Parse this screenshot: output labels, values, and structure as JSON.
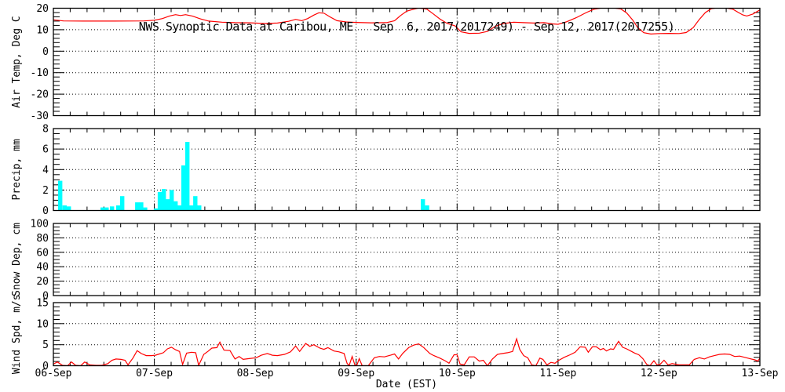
{
  "title": "NWS Synoptic Data at Caribou, ME   Sep  6, 2017(2017249) - Sep 12, 2017(2017255)",
  "xlabel": "Date (EST)",
  "colors": {
    "temp_line": "#ff0000",
    "wind_line": "#ff0000",
    "precip_bar": "#00ffff",
    "axis": "#000000",
    "background": "#ffffff"
  },
  "x_axis": {
    "tick_labels": [
      "06-Sep",
      "07-Sep",
      "08-Sep",
      "09-Sep",
      "10-Sep",
      "11-Sep",
      "12-Sep",
      "13-Sep"
    ],
    "domain_days": [
      0,
      7
    ],
    "minor_ticks_per_day": 6
  },
  "chart_data": [
    {
      "type": "line",
      "name": "air-temp",
      "ylabel": "Air Temp, Deg C",
      "ylim": [
        -30,
        20
      ],
      "yticks": [
        -30,
        -20,
        -10,
        0,
        10,
        20
      ],
      "minor_step": 2,
      "grid": [
        -20,
        -10,
        0,
        10
      ],
      "color": "#ff0000",
      "grid_on": true,
      "legend": "none",
      "series": [
        [
          0.0,
          14.6
        ],
        [
          0.1,
          14.1
        ],
        [
          0.3,
          14.0
        ],
        [
          0.6,
          14.0
        ],
        [
          0.9,
          14.1
        ],
        [
          1.0,
          14.4
        ],
        [
          1.08,
          15.2
        ],
        [
          1.15,
          16.4
        ],
        [
          1.21,
          17.0
        ],
        [
          1.26,
          16.6
        ],
        [
          1.31,
          17.0
        ],
        [
          1.38,
          16.3
        ],
        [
          1.46,
          15.0
        ],
        [
          1.54,
          14.0
        ],
        [
          1.67,
          13.5
        ],
        [
          1.8,
          13.3
        ],
        [
          1.95,
          13.2
        ],
        [
          2.1,
          12.9
        ],
        [
          2.22,
          13.1
        ],
        [
          2.33,
          13.9
        ],
        [
          2.4,
          14.8
        ],
        [
          2.46,
          14.2
        ],
        [
          2.52,
          15.2
        ],
        [
          2.58,
          16.8
        ],
        [
          2.63,
          17.9
        ],
        [
          2.68,
          17.7
        ],
        [
          2.74,
          16.0
        ],
        [
          2.81,
          14.2
        ],
        [
          2.9,
          13.6
        ],
        [
          3.0,
          13.4
        ],
        [
          3.15,
          13.2
        ],
        [
          3.3,
          13.3
        ],
        [
          3.38,
          14.2
        ],
        [
          3.44,
          16.6
        ],
        [
          3.5,
          18.6
        ],
        [
          3.56,
          19.4
        ],
        [
          3.62,
          20.1
        ],
        [
          3.7,
          19.6
        ],
        [
          3.76,
          17.5
        ],
        [
          3.83,
          15.0
        ],
        [
          3.9,
          13.0
        ],
        [
          3.98,
          11.8
        ],
        [
          4.04,
          9.0
        ],
        [
          4.12,
          8.3
        ],
        [
          4.22,
          8.4
        ],
        [
          4.3,
          9.2
        ],
        [
          4.38,
          11.6
        ],
        [
          4.46,
          12.9
        ],
        [
          4.56,
          13.5
        ],
        [
          4.66,
          13.3
        ],
        [
          4.76,
          13.1
        ],
        [
          4.86,
          13.3
        ],
        [
          4.95,
          12.7
        ],
        [
          5.0,
          12.5
        ],
        [
          5.08,
          13.6
        ],
        [
          5.18,
          15.6
        ],
        [
          5.28,
          18.0
        ],
        [
          5.36,
          19.6
        ],
        [
          5.44,
          20.2
        ],
        [
          5.55,
          20.1
        ],
        [
          5.62,
          19.7
        ],
        [
          5.68,
          17.8
        ],
        [
          5.74,
          14.5
        ],
        [
          5.79,
          11.0
        ],
        [
          5.85,
          8.6
        ],
        [
          5.92,
          8.0
        ],
        [
          6.0,
          8.2
        ],
        [
          6.1,
          8.3
        ],
        [
          6.2,
          8.2
        ],
        [
          6.27,
          8.7
        ],
        [
          6.34,
          11.0
        ],
        [
          6.4,
          14.8
        ],
        [
          6.46,
          18.0
        ],
        [
          6.52,
          19.8
        ],
        [
          6.58,
          20.2
        ],
        [
          6.66,
          20.1
        ],
        [
          6.73,
          19.6
        ],
        [
          6.78,
          18.2
        ],
        [
          6.83,
          16.9
        ],
        [
          6.87,
          16.4
        ],
        [
          6.93,
          17.3
        ],
        [
          7.0,
          19.2
        ]
      ]
    },
    {
      "type": "bar",
      "name": "precip",
      "ylabel": "Precip, mm",
      "ylim": [
        0,
        8
      ],
      "yticks": [
        0,
        2,
        4,
        6,
        8
      ],
      "minor_step": 0.5,
      "grid": [
        2,
        4,
        6
      ],
      "color": "#00ffff",
      "grid_on": true,
      "legend": "none",
      "bar_width_days": 0.0417,
      "bars": [
        [
          0.047,
          2.9
        ],
        [
          0.09,
          0.5
        ],
        [
          0.132,
          0.4
        ],
        [
          0.467,
          0.3
        ],
        [
          0.506,
          0.3
        ],
        [
          0.56,
          0.4
        ],
        [
          0.622,
          0.5
        ],
        [
          0.661,
          1.4
        ],
        [
          0.81,
          0.8
        ],
        [
          0.849,
          0.8
        ],
        [
          0.888,
          0.3
        ],
        [
          0.995,
          0.2
        ],
        [
          1.034,
          1.8
        ],
        [
          1.073,
          2.1
        ],
        [
          1.112,
          1.1
        ],
        [
          1.151,
          2.0
        ],
        [
          1.19,
          0.9
        ],
        [
          1.229,
          0.5
        ],
        [
          1.268,
          4.4
        ],
        [
          1.307,
          6.7
        ],
        [
          1.346,
          0.5
        ],
        [
          1.385,
          1.4
        ],
        [
          1.424,
          0.5
        ],
        [
          3.64,
          1.1
        ],
        [
          3.682,
          0.5
        ]
      ]
    },
    {
      "type": "line",
      "name": "snow-depth",
      "ylabel": "Snow Dep, cm",
      "ylim": [
        0,
        100
      ],
      "yticks": [
        0,
        20,
        40,
        60,
        80,
        100
      ],
      "minor_step": 5,
      "grid": [
        20,
        40,
        60,
        80
      ],
      "color": "#ff0000",
      "grid_on": true,
      "legend": "none",
      "series": []
    },
    {
      "type": "line",
      "name": "wind-speed",
      "ylabel": "Wind Spd, m/s",
      "ylim": [
        0,
        15
      ],
      "yticks": [
        0,
        5,
        10,
        15
      ],
      "minor_step": 1,
      "grid": [
        5,
        10
      ],
      "color": "#ff0000",
      "grid_on": true,
      "legend": "none",
      "series": [
        [
          0.0,
          0.4
        ],
        [
          0.04,
          0.9
        ],
        [
          0.09,
          0.1
        ],
        [
          0.14,
          0.0
        ],
        [
          0.18,
          0.9
        ],
        [
          0.22,
          0.1
        ],
        [
          0.27,
          0.0
        ],
        [
          0.31,
          0.9
        ],
        [
          0.36,
          0.2
        ],
        [
          0.42,
          0.1
        ],
        [
          0.48,
          0.1
        ],
        [
          0.54,
          0.5
        ],
        [
          0.58,
          1.3
        ],
        [
          0.62,
          1.6
        ],
        [
          0.67,
          1.5
        ],
        [
          0.71,
          1.3
        ],
        [
          0.74,
          0.2
        ],
        [
          0.79,
          1.9
        ],
        [
          0.83,
          3.6
        ],
        [
          0.87,
          2.9
        ],
        [
          0.92,
          2.4
        ],
        [
          0.97,
          2.4
        ],
        [
          1.01,
          2.5
        ],
        [
          1.05,
          2.8
        ],
        [
          1.09,
          3.1
        ],
        [
          1.13,
          4.0
        ],
        [
          1.17,
          4.4
        ],
        [
          1.21,
          3.8
        ],
        [
          1.25,
          3.4
        ],
        [
          1.28,
          0.3
        ],
        [
          1.32,
          3.0
        ],
        [
          1.37,
          3.2
        ],
        [
          1.41,
          3.1
        ],
        [
          1.44,
          0.1
        ],
        [
          1.49,
          2.7
        ],
        [
          1.53,
          3.4
        ],
        [
          1.57,
          4.2
        ],
        [
          1.62,
          4.3
        ],
        [
          1.65,
          5.6
        ],
        [
          1.69,
          3.7
        ],
        [
          1.75,
          3.6
        ],
        [
          1.8,
          1.6
        ],
        [
          1.84,
          2.2
        ],
        [
          1.88,
          1.5
        ],
        [
          1.94,
          1.7
        ],
        [
          2.01,
          1.9
        ],
        [
          2.06,
          2.5
        ],
        [
          2.12,
          2.9
        ],
        [
          2.17,
          2.5
        ],
        [
          2.22,
          2.4
        ],
        [
          2.29,
          2.7
        ],
        [
          2.35,
          3.3
        ],
        [
          2.4,
          4.7
        ],
        [
          2.44,
          3.4
        ],
        [
          2.5,
          5.3
        ],
        [
          2.54,
          4.6
        ],
        [
          2.58,
          5.0
        ],
        [
          2.64,
          4.2
        ],
        [
          2.68,
          3.9
        ],
        [
          2.72,
          4.3
        ],
        [
          2.78,
          3.5
        ],
        [
          2.83,
          3.3
        ],
        [
          2.88,
          2.9
        ],
        [
          2.91,
          0.6
        ],
        [
          2.93,
          0.0
        ],
        [
          2.96,
          2.2
        ],
        [
          2.99,
          0.0
        ],
        [
          3.01,
          0.3
        ],
        [
          3.03,
          1.7
        ],
        [
          3.06,
          0.0
        ],
        [
          3.12,
          0.0
        ],
        [
          3.18,
          1.9
        ],
        [
          3.23,
          2.2
        ],
        [
          3.28,
          2.1
        ],
        [
          3.34,
          2.5
        ],
        [
          3.38,
          2.8
        ],
        [
          3.42,
          1.6
        ],
        [
          3.46,
          2.9
        ],
        [
          3.52,
          4.3
        ],
        [
          3.57,
          4.9
        ],
        [
          3.62,
          5.2
        ],
        [
          3.67,
          4.3
        ],
        [
          3.73,
          2.9
        ],
        [
          3.77,
          2.4
        ],
        [
          3.83,
          1.8
        ],
        [
          3.88,
          1.2
        ],
        [
          3.92,
          0.6
        ],
        [
          3.97,
          2.6
        ],
        [
          4.0,
          2.6
        ],
        [
          4.03,
          0.4
        ],
        [
          4.07,
          0.2
        ],
        [
          4.12,
          2.1
        ],
        [
          4.17,
          2.1
        ],
        [
          4.22,
          1.1
        ],
        [
          4.26,
          1.3
        ],
        [
          4.3,
          0.0
        ],
        [
          4.35,
          1.6
        ],
        [
          4.4,
          2.7
        ],
        [
          4.45,
          2.9
        ],
        [
          4.5,
          3.1
        ],
        [
          4.55,
          3.4
        ],
        [
          4.59,
          6.4
        ],
        [
          4.62,
          3.9
        ],
        [
          4.66,
          2.4
        ],
        [
          4.7,
          1.9
        ],
        [
          4.74,
          0.2
        ],
        [
          4.78,
          0.0
        ],
        [
          4.82,
          1.8
        ],
        [
          4.85,
          1.5
        ],
        [
          4.89,
          0.2
        ],
        [
          4.93,
          0.8
        ],
        [
          4.97,
          0.6
        ],
        [
          5.0,
          1.2
        ],
        [
          5.06,
          2.0
        ],
        [
          5.12,
          2.6
        ],
        [
          5.17,
          3.2
        ],
        [
          5.22,
          4.5
        ],
        [
          5.27,
          4.4
        ],
        [
          5.3,
          3.2
        ],
        [
          5.34,
          4.5
        ],
        [
          5.38,
          4.5
        ],
        [
          5.42,
          3.8
        ],
        [
          5.45,
          4.1
        ],
        [
          5.48,
          3.5
        ],
        [
          5.52,
          4.0
        ],
        [
          5.55,
          3.9
        ],
        [
          5.6,
          5.8
        ],
        [
          5.64,
          4.4
        ],
        [
          5.68,
          4.0
        ],
        [
          5.72,
          3.5
        ],
        [
          5.76,
          3.0
        ],
        [
          5.8,
          2.6
        ],
        [
          5.84,
          1.7
        ],
        [
          5.88,
          0.3
        ],
        [
          5.91,
          0.0
        ],
        [
          5.95,
          1.2
        ],
        [
          5.98,
          0.2
        ],
        [
          6.01,
          0.3
        ],
        [
          6.05,
          1.3
        ],
        [
          6.09,
          0.2
        ],
        [
          6.13,
          0.5
        ],
        [
          6.2,
          0.2
        ],
        [
          6.3,
          0.2
        ],
        [
          6.35,
          1.5
        ],
        [
          6.4,
          1.9
        ],
        [
          6.45,
          1.6
        ],
        [
          6.5,
          2.1
        ],
        [
          6.55,
          2.4
        ],
        [
          6.6,
          2.7
        ],
        [
          6.65,
          2.8
        ],
        [
          6.7,
          2.7
        ],
        [
          6.75,
          2.2
        ],
        [
          6.8,
          2.3
        ],
        [
          6.85,
          2.0
        ],
        [
          6.9,
          1.7
        ],
        [
          6.95,
          1.4
        ],
        [
          6.98,
          1.1
        ],
        [
          7.0,
          1.8
        ]
      ]
    }
  ]
}
